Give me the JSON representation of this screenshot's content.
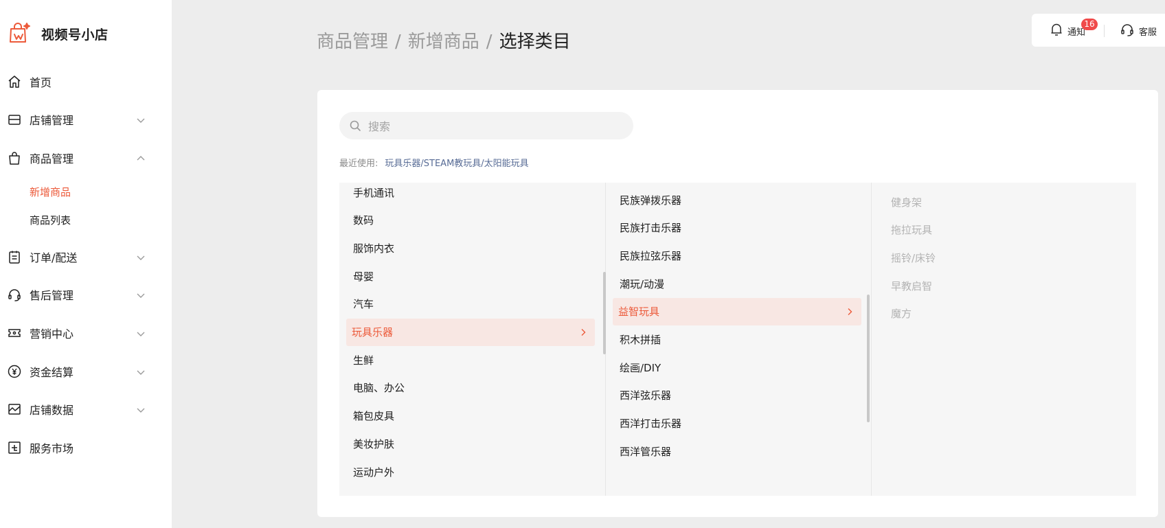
{
  "app": {
    "name": "视频号小店"
  },
  "sidebar": {
    "items": [
      {
        "label": "首页",
        "icon": "home-icon",
        "expandable": false
      },
      {
        "label": "店铺管理",
        "icon": "store-icon",
        "expandable": true,
        "expanded": false
      },
      {
        "label": "商品管理",
        "icon": "bag-icon",
        "expandable": true,
        "expanded": true,
        "children": [
          {
            "label": "新增商品",
            "active": true
          },
          {
            "label": "商品列表",
            "active": false
          }
        ]
      },
      {
        "label": "订单/配送",
        "icon": "order-icon",
        "expandable": true,
        "expanded": false
      },
      {
        "label": "售后管理",
        "icon": "headset-icon",
        "expandable": true,
        "expanded": false
      },
      {
        "label": "营销中心",
        "icon": "coupon-icon",
        "expandable": true,
        "expanded": false
      },
      {
        "label": "资金结算",
        "icon": "yuan-icon",
        "expandable": true,
        "expanded": false
      },
      {
        "label": "店铺数据",
        "icon": "chart-icon",
        "expandable": true,
        "expanded": false
      },
      {
        "label": "服务市场",
        "icon": "market-icon",
        "expandable": false
      }
    ]
  },
  "breadcrumb": {
    "part1": "商品管理",
    "part2": "新增商品",
    "current": "选择类目",
    "separator": "/"
  },
  "topbar": {
    "notify_label": "通知",
    "notify_count": "16",
    "service_label": "客服"
  },
  "search": {
    "placeholder": "搜索",
    "value": ""
  },
  "recent": {
    "label": "最近使用:",
    "link": "玩具乐器/STEAM教玩具/太阳能玩具"
  },
  "categories": {
    "level1": [
      "手机通讯",
      "数码",
      "服饰内衣",
      "母婴",
      "汽车",
      "玩具乐器",
      "生鲜",
      "电脑、办公",
      "箱包皮具",
      "美妆护肤",
      "运动户外"
    ],
    "level1_selected": "玩具乐器",
    "level2": [
      "民族弹拨乐器",
      "民族打击乐器",
      "民族拉弦乐器",
      "潮玩/动漫",
      "益智玩具",
      "积木拼插",
      "绘画/DIY",
      "西洋弦乐器",
      "西洋打击乐器",
      "西洋管乐器"
    ],
    "level2_selected": "益智玩具",
    "level3": [
      "健身架",
      "拖拉玩具",
      "摇铃/床铃",
      "早教启智",
      "魔方"
    ]
  },
  "colors": {
    "accent": "#ec5a3a",
    "link": "#576b95",
    "badge": "#f04a4a"
  }
}
